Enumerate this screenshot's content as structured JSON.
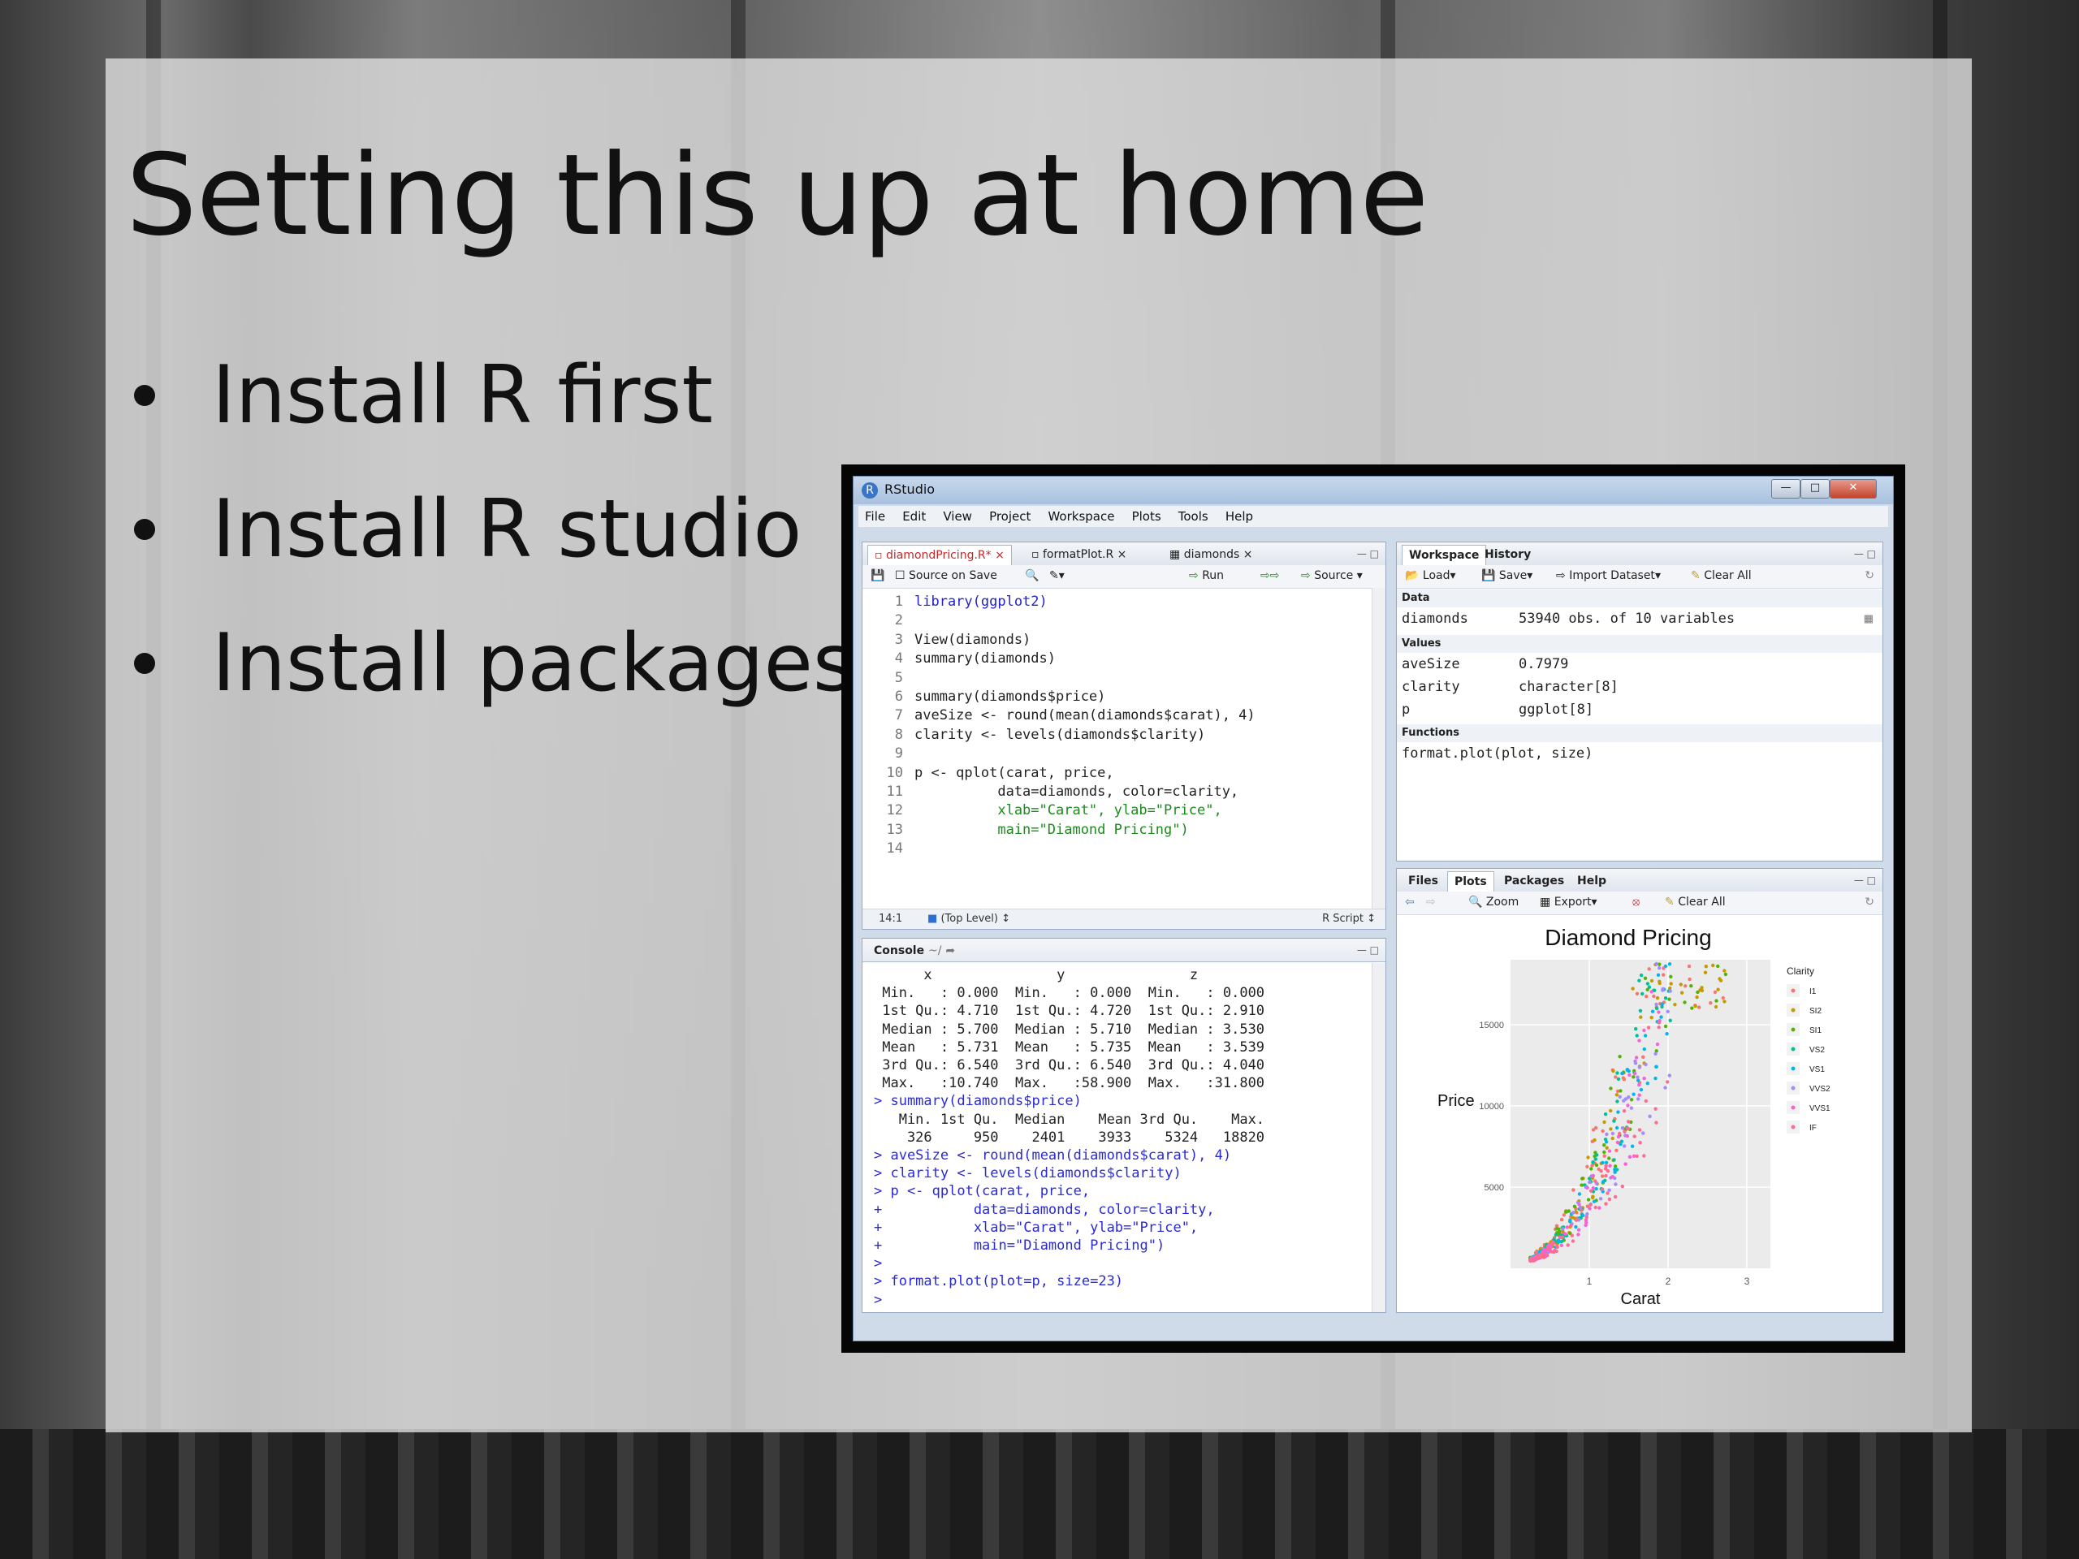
{
  "slide": {
    "title": "Setting this up at home",
    "bullets": [
      "Install R first",
      "Install R studio",
      "Install packages"
    ]
  },
  "window": {
    "title": "RStudio",
    "menu": [
      "File",
      "Edit",
      "View",
      "Project",
      "Workspace",
      "Plots",
      "Tools",
      "Help"
    ]
  },
  "editor": {
    "tabs": [
      "diamondPricing.R*",
      "formatPlot.R",
      "diamonds"
    ],
    "toolbar": {
      "source_on_save": "Source on Save",
      "run": "Run",
      "source": "Source"
    },
    "lines": [
      "library(ggplot2)",
      "",
      "View(diamonds)",
      "summary(diamonds)",
      "",
      "summary(diamonds$price)",
      "aveSize <- round(mean(diamonds$carat), 4)",
      "clarity <- levels(diamonds$clarity)",
      "",
      "p <- qplot(carat, price,",
      "          data=diamonds, color=clarity,",
      "          xlab=\"Carat\", ylab=\"Price\",",
      "          main=\"Diamond Pricing\")",
      ""
    ],
    "status": {
      "position": "14:1",
      "scope": "(Top Level)",
      "filetype": "R Script"
    }
  },
  "console": {
    "title": "Console",
    "path": "~/",
    "lines": [
      "      x               y               z",
      " Min.   : 0.000  Min.   : 0.000  Min.   : 0.000",
      " 1st Qu.: 4.710  1st Qu.: 4.720  1st Qu.: 2.910",
      " Median : 5.700  Median : 5.710  Median : 3.530",
      " Mean   : 5.731  Mean   : 5.735  Mean   : 3.539",
      " 3rd Qu.: 6.540  3rd Qu.: 6.540  3rd Qu.: 4.040",
      " Max.   :10.740  Max.   :58.900  Max.   :31.800",
      "> summary(diamonds$price)",
      "   Min. 1st Qu.  Median    Mean 3rd Qu.    Max.",
      "    326     950    2401    3933    5324   18820",
      "> aveSize <- round(mean(diamonds$carat), 4)",
      "> clarity <- levels(diamonds$clarity)",
      "> p <- qplot(carat, price,",
      "+           data=diamonds, color=clarity,",
      "+           xlab=\"Carat\", ylab=\"Price\",",
      "+           main=\"Diamond Pricing\")",
      "> ",
      "> format.plot(plot=p, size=23)",
      "> "
    ]
  },
  "workspace": {
    "tabs": [
      "Workspace",
      "History"
    ],
    "toolbar": {
      "load": "Load",
      "save": "Save",
      "import": "Import Dataset",
      "clear": "Clear All"
    },
    "sections": {
      "data": "Data",
      "values": "Values",
      "functions": "Functions"
    },
    "data": [
      {
        "name": "diamonds",
        "value": "53940 obs. of 10 variables"
      }
    ],
    "values": [
      {
        "name": "aveSize",
        "value": "0.7979"
      },
      {
        "name": "clarity",
        "value": "character[8]"
      },
      {
        "name": "p",
        "value": "ggplot[8]"
      }
    ],
    "functions": [
      "format.plot(plot, size)"
    ]
  },
  "files": {
    "tabs": [
      "Files",
      "Plots",
      "Packages",
      "Help"
    ],
    "toolbar": {
      "zoom": "Zoom",
      "export": "Export",
      "clear": "Clear All"
    }
  },
  "chart_data": {
    "type": "scatter",
    "title": "Diamond Pricing",
    "xlabel": "Carat",
    "ylabel": "Price",
    "xlim": [
      0,
      3.3
    ],
    "ylim": [
      0,
      19000
    ],
    "xticks": [
      "1",
      "2",
      "3"
    ],
    "yticks": [
      "5000",
      "10000",
      "15000"
    ],
    "legend_title": "Clarity",
    "legend_position": "right",
    "series": [
      {
        "name": "I1",
        "color": "#f8766d"
      },
      {
        "name": "SI2",
        "color": "#c49a00"
      },
      {
        "name": "SI1",
        "color": "#53b400"
      },
      {
        "name": "VS2",
        "color": "#00c094"
      },
      {
        "name": "VS1",
        "color": "#00b6eb"
      },
      {
        "name": "VVS2",
        "color": "#a58aff"
      },
      {
        "name": "VVS1",
        "color": "#fb61d7"
      },
      {
        "name": "IF",
        "color": "#ff6c91"
      }
    ]
  }
}
